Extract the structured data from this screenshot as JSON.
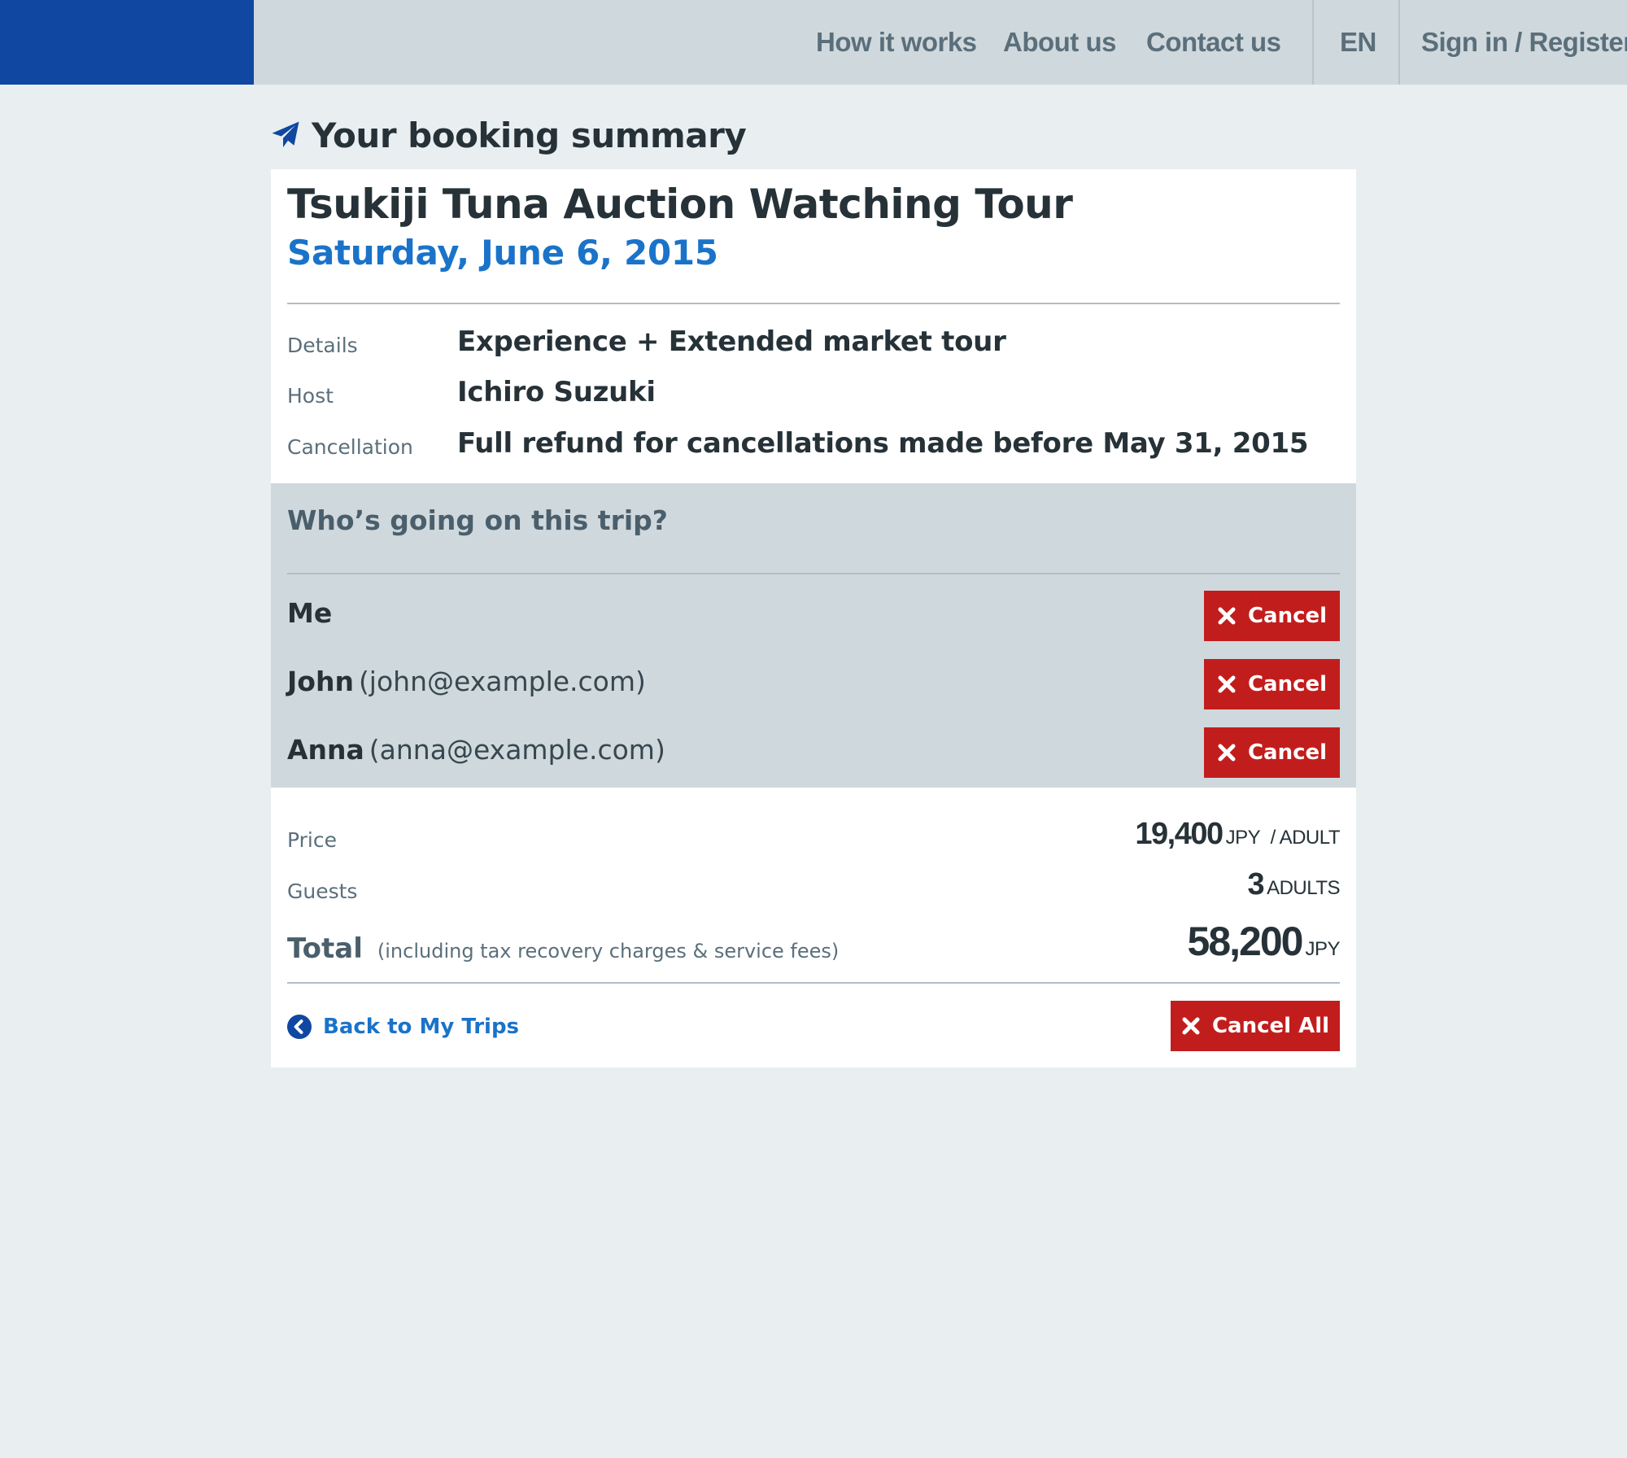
{
  "nav": {
    "links": [
      "How it works",
      "About us",
      "Contact us"
    ],
    "language": "EN",
    "signin": "Sign in / Register"
  },
  "page": {
    "heading": "Your booking summary",
    "heading_icon": "paper-plane-icon"
  },
  "tour": {
    "title": "Tsukiji Tuna Auction Watching Tour",
    "date": "Saturday, June 6, 2015"
  },
  "details": [
    {
      "label": "Details",
      "value": "Experience + Extended market tour"
    },
    {
      "label": "Host",
      "value": "Ichiro Suzuki"
    },
    {
      "label": "Cancellation",
      "value": "Full refund for cancellations made before May 31, 2015"
    }
  ],
  "travellers": {
    "heading": "Who’s going on this trip?",
    "cancel_label": "Cancel",
    "people": [
      {
        "name": "Me",
        "email": ""
      },
      {
        "name": "John",
        "email": "(john@example.com)"
      },
      {
        "name": "Anna",
        "email": "(anna@example.com)"
      }
    ]
  },
  "pricing": {
    "price_label": "Price",
    "price_amount": "19,400",
    "price_unit": "JPY",
    "price_per": "/ ADULT",
    "guests_label": "Guests",
    "guests_count": "3",
    "guests_unit": "ADULTS",
    "total_label": "Total",
    "total_note": "(including tax recovery charges & service fees)",
    "total_amount": "58,200",
    "total_unit": "JPY"
  },
  "actions": {
    "back_label": "Back to My Trips",
    "cancel_all_label": "Cancel All"
  },
  "colors": {
    "brand": "#0f47a1",
    "accent_link": "#1a73c9",
    "danger": "#c21d1d",
    "nav_bg": "#cfd8dd",
    "page_bg": "#e9eef1"
  }
}
